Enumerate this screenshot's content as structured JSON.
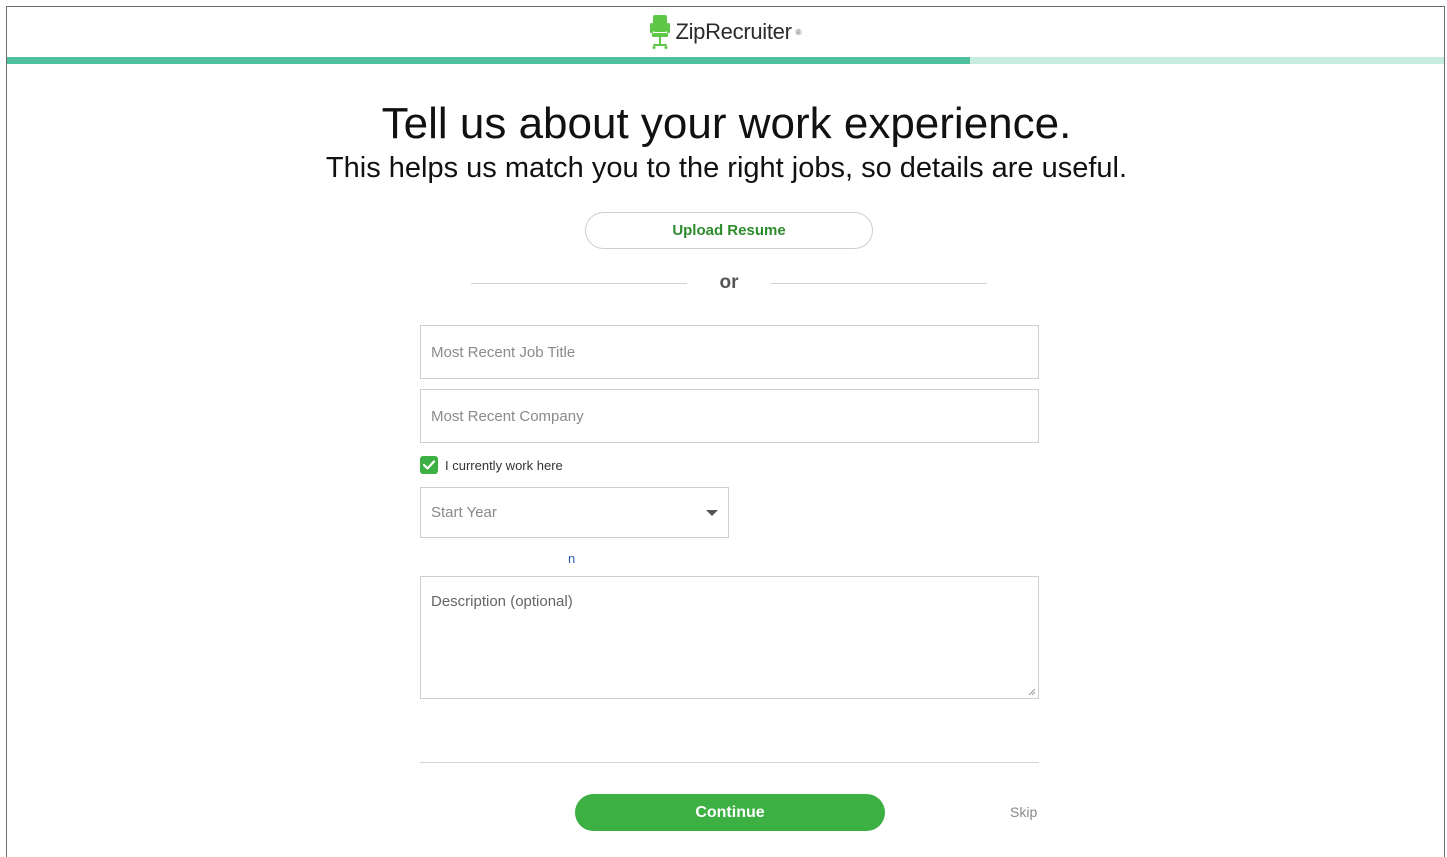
{
  "header": {
    "brand": "ZipRecruiter",
    "brand_mark": "®",
    "brand_color": "#5ec845",
    "icon": "chair-icon"
  },
  "progress": {
    "fraction": 0.67,
    "fill_color": "#4fbf9c",
    "track_color": "#c7ece0"
  },
  "main": {
    "title": "Tell us about your work experience.",
    "subtitle": "This helps us match you to the right jobs, so details are useful."
  },
  "upload": {
    "label": "Upload Resume"
  },
  "separator": {
    "label": "or"
  },
  "form": {
    "job_title": {
      "placeholder": "Most Recent Job Title",
      "value": ""
    },
    "company": {
      "placeholder": "Most Recent Company",
      "value": ""
    },
    "current": {
      "label": "I currently work here",
      "checked": true,
      "icon": "checkmark-icon"
    },
    "start_year": {
      "placeholder": "Start Year",
      "icon": "chevron-down-icon"
    },
    "stray_link": "n",
    "description": {
      "placeholder": "Description (optional)",
      "value": ""
    }
  },
  "actions": {
    "continue_label": "Continue",
    "skip_label": "Skip",
    "accent": "#3cb043"
  }
}
